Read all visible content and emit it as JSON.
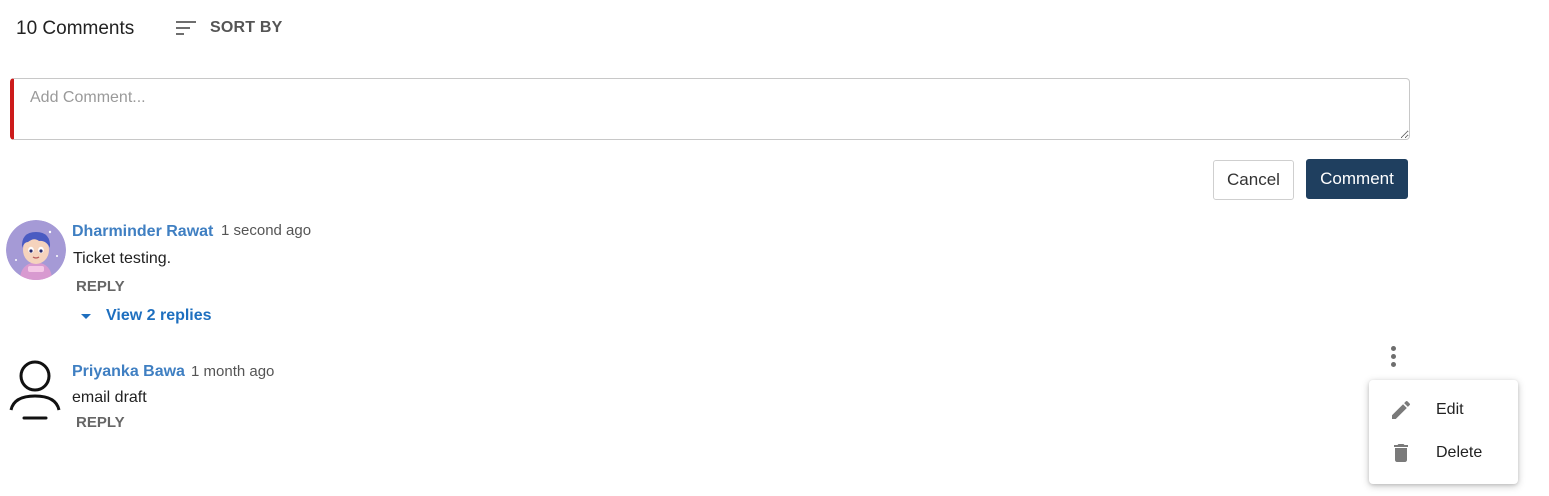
{
  "header": {
    "comment_count": "10 Comments",
    "sort_label": "SORT BY"
  },
  "composer": {
    "placeholder": "Add Comment...",
    "value": "",
    "cancel_label": "Cancel",
    "submit_label": "Comment"
  },
  "comments": [
    {
      "author": "Dharminder Rawat",
      "timestamp": "1 second ago",
      "text": "Ticket testing.",
      "reply_label": "REPLY",
      "view_replies_label": "View 2 replies",
      "avatar": "cartoon-boy-avatar"
    },
    {
      "author": "Priyanka Bawa",
      "timestamp": "1 month ago",
      "text": "email draft",
      "reply_label": "REPLY",
      "avatar": "generic-user-avatar"
    }
  ],
  "context_menu": {
    "items": [
      {
        "label": "Edit",
        "icon": "pencil-icon"
      },
      {
        "label": "Delete",
        "icon": "trash-icon"
      }
    ]
  },
  "colors": {
    "accent_red": "#cc1b1b",
    "primary_button": "#1f3f5f",
    "author_link": "#3f7fc2",
    "replies_link": "#1e6fbf"
  }
}
